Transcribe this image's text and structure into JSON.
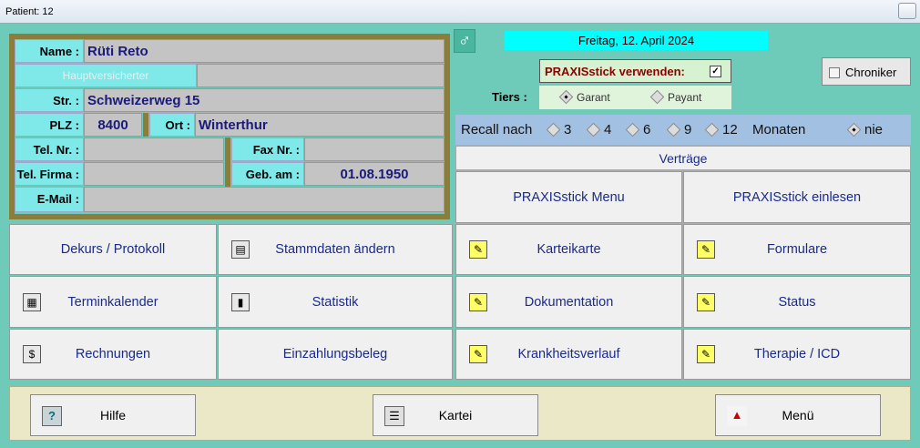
{
  "window": {
    "title": "Patient: 12"
  },
  "patient": {
    "name_label": "Name :",
    "name": "Rüti Reto",
    "hv_label": "Hauptversicherter",
    "street_label": "Str. :",
    "street": "Schweizerweg 15",
    "plz_label": "PLZ :",
    "plz": "8400",
    "ort_label": "Ort :",
    "ort": "Winterthur",
    "tel_label": "Tel. Nr. :",
    "fax_label": "Fax Nr. :",
    "telfirma_label": "Tel. Firma :",
    "geb_label": "Geb. am :",
    "geb": "01.08.1950",
    "email_label": "E-Mail :"
  },
  "date": "Freitag, 12. April 2024",
  "praxisstick_use": {
    "label": "PRAXISstick verwenden:",
    "checked": true
  },
  "chroniker": {
    "label": "Chroniker"
  },
  "tiers": {
    "label": "Tiers :",
    "garant": "Garant",
    "payant": "Payant"
  },
  "recall": {
    "label": "Recall nach",
    "options": [
      "3",
      "4",
      "6",
      "9",
      "12"
    ],
    "unit": "Monaten",
    "nie": "nie"
  },
  "vertraege": "Verträge",
  "buttons": {
    "px_menu": "PRAXISstick Menu",
    "px_read": "PRAXISstick einlesen",
    "dekurs": "Dekurs / Protokoll",
    "stammdaten": "Stammdaten ändern",
    "karteikarte": "Karteikarte",
    "formulare": "Formulare",
    "terminkalender": "Terminkalender",
    "statistik": "Statistik",
    "dokumentation": "Dokumentation",
    "status": "Status",
    "rechnungen": "Rechnungen",
    "einzahlung": "Einzahlungsbeleg",
    "krankheitsverlauf": "Krankheitsverlauf",
    "therapie": "Therapie / ICD"
  },
  "bottom": {
    "hilfe": "Hilfe",
    "kartei": "Kartei",
    "menu": "Menü"
  },
  "colors": {
    "background": "#6fcbb9",
    "card_border": "#8b7d3a",
    "label_bg": "#7fe8e8",
    "date_bg": "#00ffff",
    "text_blue": "#1a2a8a"
  }
}
